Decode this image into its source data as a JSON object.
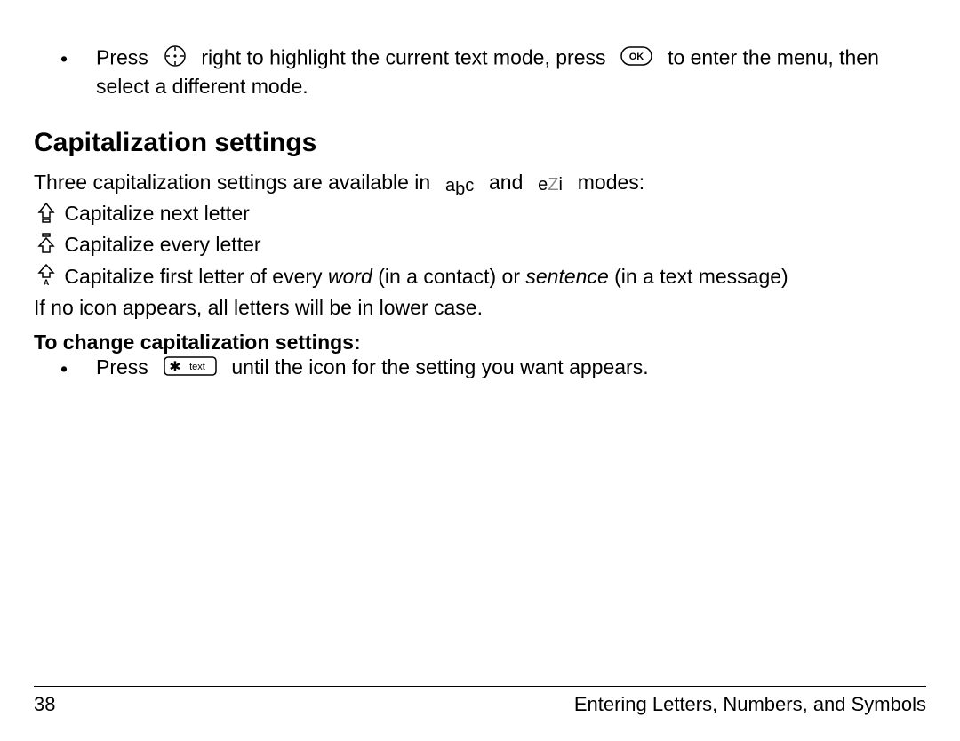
{
  "intro": {
    "bullet_press": "Press",
    "after_nav": "right to highlight the current text mode, press",
    "after_ok": "to enter the menu, then select a different mode."
  },
  "heading": "Capitalization settings",
  "para1_a": "Three capitalization settings are available in",
  "para1_b": "and",
  "para1_c": "modes:",
  "mode_abc": "a",
  "mode_abc2": "b",
  "mode_abc3": "c",
  "mode_ezi_e": "e",
  "mode_ezi_z": "Z",
  "mode_ezi_i": "i",
  "cap1": "Capitalize next letter",
  "cap2": "Capitalize every letter",
  "cap3_a": "Capitalize first letter of every",
  "cap3_word": "word",
  "cap3_b": "(in a contact) or",
  "cap3_sentence": "sentence",
  "cap3_c": "(in a text message)",
  "noicon": "If no icon appears, all letters will be in lower case.",
  "subheading": "To change capitalization settings:",
  "step_press": "Press",
  "step_after": "until the icon for the setting you want appears.",
  "key_text": "text",
  "footer_page": "38",
  "footer_chapter": "Entering Letters, Numbers, and Symbols"
}
